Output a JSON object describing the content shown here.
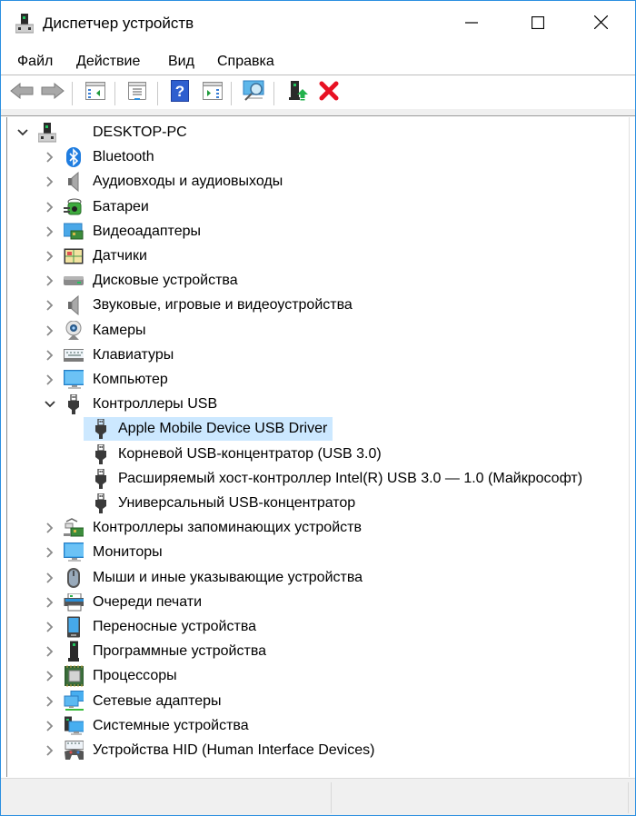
{
  "window": {
    "title": "Диспетчер устройств",
    "controls": {
      "minimize": "minimize",
      "maximize": "maximize",
      "close": "close"
    }
  },
  "menu": [
    {
      "label": "Файл"
    },
    {
      "label": "Действие"
    },
    {
      "label": "Вид"
    },
    {
      "label": "Справка"
    }
  ],
  "toolbar": [
    {
      "icon": "back-arrow-icon",
      "enabled": false
    },
    {
      "icon": "forward-arrow-icon",
      "enabled": false
    },
    {
      "icon": "show-hide-console-tree-icon"
    },
    {
      "icon": "properties-icon"
    },
    {
      "icon": "help-icon"
    },
    {
      "icon": "show-action-pane-icon"
    },
    {
      "icon": "scan-hardware-changes-icon"
    },
    {
      "icon": "update-driver-icon"
    },
    {
      "icon": "uninstall-device-icon",
      "color": "#e81123"
    }
  ],
  "tree": {
    "root": {
      "label": "DESKTOP-PC",
      "expanded": true,
      "icon": "computer-tower-icon"
    },
    "categories": [
      {
        "label": "Bluetooth",
        "icon": "bluetooth-icon",
        "expanded": false
      },
      {
        "label": "Аудиовходы и аудиовыходы",
        "icon": "speaker-icon",
        "expanded": false
      },
      {
        "label": "Батареи",
        "icon": "battery-icon",
        "expanded": false
      },
      {
        "label": "Видеоадаптеры",
        "icon": "display-adapter-icon",
        "expanded": false
      },
      {
        "label": "Датчики",
        "icon": "sensor-icon",
        "expanded": false
      },
      {
        "label": "Дисковые устройства",
        "icon": "disk-drive-icon",
        "expanded": false
      },
      {
        "label": "Звуковые, игровые и видеоустройства",
        "icon": "speaker-icon",
        "expanded": false
      },
      {
        "label": "Камеры",
        "icon": "webcam-icon",
        "expanded": false
      },
      {
        "label": "Клавиатуры",
        "icon": "keyboard-icon",
        "expanded": false
      },
      {
        "label": "Компьютер",
        "icon": "monitor-icon",
        "expanded": false
      },
      {
        "label": "Контроллеры USB",
        "icon": "usb-plug-icon",
        "expanded": true,
        "children": [
          {
            "label": "Apple Mobile Device USB Driver",
            "selected": true
          },
          {
            "label": "Корневой USB-концентратор (USB 3.0)"
          },
          {
            "label": "Расширяемый хост-контроллер Intel(R) USB 3.0 — 1.0 (Майкрософт)"
          },
          {
            "label": "Универсальный USB-концентратор"
          }
        ]
      },
      {
        "label": "Контроллеры запоминающих устройств",
        "icon": "storage-controller-icon",
        "expanded": false
      },
      {
        "label": "Мониторы",
        "icon": "monitor-icon",
        "expanded": false
      },
      {
        "label": "Мыши и иные указывающие устройства",
        "icon": "mouse-icon",
        "expanded": false
      },
      {
        "label": "Очереди печати",
        "icon": "printer-icon",
        "expanded": false
      },
      {
        "label": "Переносные устройства",
        "icon": "portable-device-icon",
        "expanded": false
      },
      {
        "label": "Программные устройства",
        "icon": "software-device-icon",
        "expanded": false
      },
      {
        "label": "Процессоры",
        "icon": "processor-icon",
        "expanded": false
      },
      {
        "label": "Сетевые адаптеры",
        "icon": "network-adapter-icon",
        "expanded": false
      },
      {
        "label": "Системные устройства",
        "icon": "system-devices-icon",
        "expanded": false
      },
      {
        "label": "Устройства HID (Human Interface Devices)",
        "icon": "hid-icon",
        "expanded": false
      }
    ]
  },
  "colors": {
    "window_border": "#2b8fe0",
    "selection": "#cce8ff",
    "statusbar": "#f0f0f0"
  }
}
